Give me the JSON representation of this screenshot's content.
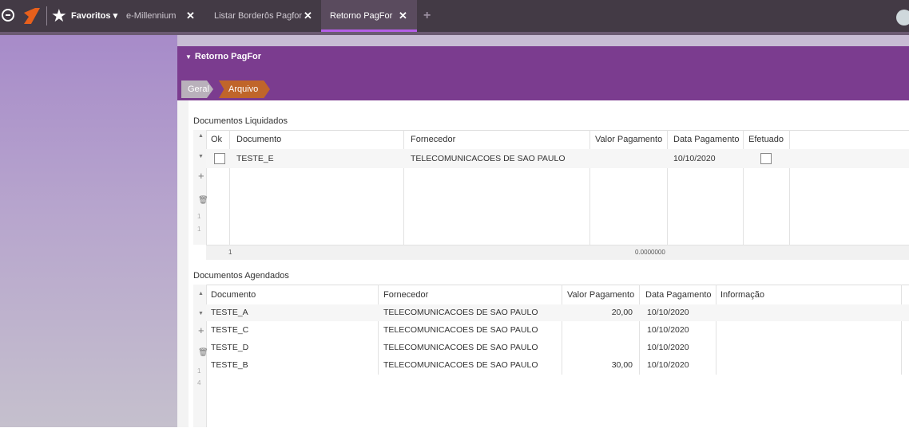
{
  "topbar": {
    "favorites_label": "Favoritos ▾",
    "tabs": [
      {
        "label": "e-Millennium",
        "close": "✕"
      },
      {
        "label": "Listar Borderôs Pagfor",
        "close": "✕"
      },
      {
        "label": "Retorno PagFor",
        "close": "✕"
      }
    ],
    "add_tab": "+",
    "icons": [
      "logout-icon",
      "logo-icon",
      "star-icon",
      "plus-icon",
      "user-avatar-icon"
    ]
  },
  "panel": {
    "title": "Retorno PagFor",
    "caret": "▼",
    "breadcrumbs": [
      "Geral",
      "Arquivo"
    ]
  },
  "liquidados": {
    "title": "Documentos Liquidados",
    "headers": [
      "Ok",
      "Documento",
      "Fornecedor",
      "Valor Pagamento",
      "Data Pagamento",
      "Efetuado"
    ],
    "rows": [
      {
        "ok": false,
        "documento": "TESTE_E",
        "fornecedor": "TELECOMUNICACOES DE SAO PAULO",
        "valor": "",
        "data": "10/10/2020",
        "efetuado": false
      }
    ],
    "footer_count": "1",
    "footer_total": "0.0000000",
    "gutter_nums": [
      "1",
      "1"
    ]
  },
  "agendados": {
    "title": "Documentos Agendados",
    "headers": [
      "Documento",
      "Fornecedor",
      "Valor Pagamento",
      "Data Pagamento",
      "Informação"
    ],
    "rows": [
      {
        "documento": "TESTE_A",
        "fornecedor": "TELECOMUNICACOES DE SAO PAULO",
        "valor": "20,00",
        "data": "10/10/2020",
        "info": ""
      },
      {
        "documento": "TESTE_C",
        "fornecedor": "TELECOMUNICACOES DE SAO PAULO",
        "valor": "",
        "data": "10/10/2020",
        "info": ""
      },
      {
        "documento": "TESTE_D",
        "fornecedor": "TELECOMUNICACOES DE SAO PAULO",
        "valor": "",
        "data": "10/10/2020",
        "info": ""
      },
      {
        "documento": "TESTE_B",
        "fornecedor": "TELECOMUNICACOES DE SAO PAULO",
        "valor": "30,00",
        "data": "10/10/2020",
        "info": ""
      }
    ],
    "gutter_nums": [
      "1",
      "4"
    ]
  },
  "grid_icons": {
    "sort_up": "▲",
    "row_caret": "▼",
    "add": "+",
    "delete": "🗑"
  },
  "colors": {
    "topbar": "#433a45",
    "header_purple": "#7b3c8f",
    "crumb_active": "#c0652a",
    "crumb_inactive": "#b9b1bb",
    "tab_underline": "#b55fe8",
    "logo": "#e8601c"
  }
}
